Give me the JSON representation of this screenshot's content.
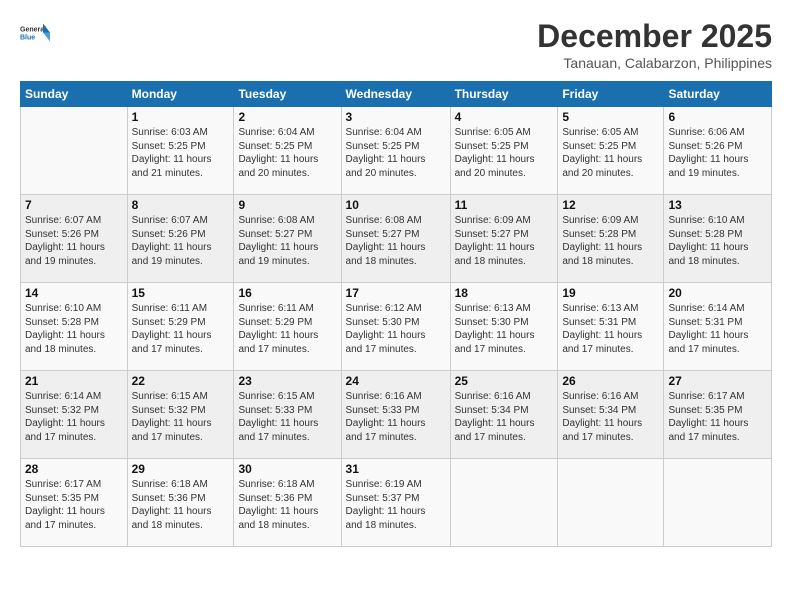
{
  "logo": {
    "line1": "General",
    "line2": "Blue"
  },
  "title": "December 2025",
  "subtitle": "Tanauan, Calabarzon, Philippines",
  "weekdays": [
    "Sunday",
    "Monday",
    "Tuesday",
    "Wednesday",
    "Thursday",
    "Friday",
    "Saturday"
  ],
  "weeks": [
    [
      {
        "day": "",
        "info": ""
      },
      {
        "day": "1",
        "info": "Sunrise: 6:03 AM\nSunset: 5:25 PM\nDaylight: 11 hours\nand 21 minutes."
      },
      {
        "day": "2",
        "info": "Sunrise: 6:04 AM\nSunset: 5:25 PM\nDaylight: 11 hours\nand 20 minutes."
      },
      {
        "day": "3",
        "info": "Sunrise: 6:04 AM\nSunset: 5:25 PM\nDaylight: 11 hours\nand 20 minutes."
      },
      {
        "day": "4",
        "info": "Sunrise: 6:05 AM\nSunset: 5:25 PM\nDaylight: 11 hours\nand 20 minutes."
      },
      {
        "day": "5",
        "info": "Sunrise: 6:05 AM\nSunset: 5:25 PM\nDaylight: 11 hours\nand 20 minutes."
      },
      {
        "day": "6",
        "info": "Sunrise: 6:06 AM\nSunset: 5:26 PM\nDaylight: 11 hours\nand 19 minutes."
      }
    ],
    [
      {
        "day": "7",
        "info": "Sunrise: 6:07 AM\nSunset: 5:26 PM\nDaylight: 11 hours\nand 19 minutes."
      },
      {
        "day": "8",
        "info": "Sunrise: 6:07 AM\nSunset: 5:26 PM\nDaylight: 11 hours\nand 19 minutes."
      },
      {
        "day": "9",
        "info": "Sunrise: 6:08 AM\nSunset: 5:27 PM\nDaylight: 11 hours\nand 19 minutes."
      },
      {
        "day": "10",
        "info": "Sunrise: 6:08 AM\nSunset: 5:27 PM\nDaylight: 11 hours\nand 18 minutes."
      },
      {
        "day": "11",
        "info": "Sunrise: 6:09 AM\nSunset: 5:27 PM\nDaylight: 11 hours\nand 18 minutes."
      },
      {
        "day": "12",
        "info": "Sunrise: 6:09 AM\nSunset: 5:28 PM\nDaylight: 11 hours\nand 18 minutes."
      },
      {
        "day": "13",
        "info": "Sunrise: 6:10 AM\nSunset: 5:28 PM\nDaylight: 11 hours\nand 18 minutes."
      }
    ],
    [
      {
        "day": "14",
        "info": "Sunrise: 6:10 AM\nSunset: 5:28 PM\nDaylight: 11 hours\nand 18 minutes."
      },
      {
        "day": "15",
        "info": "Sunrise: 6:11 AM\nSunset: 5:29 PM\nDaylight: 11 hours\nand 17 minutes."
      },
      {
        "day": "16",
        "info": "Sunrise: 6:11 AM\nSunset: 5:29 PM\nDaylight: 11 hours\nand 17 minutes."
      },
      {
        "day": "17",
        "info": "Sunrise: 6:12 AM\nSunset: 5:30 PM\nDaylight: 11 hours\nand 17 minutes."
      },
      {
        "day": "18",
        "info": "Sunrise: 6:13 AM\nSunset: 5:30 PM\nDaylight: 11 hours\nand 17 minutes."
      },
      {
        "day": "19",
        "info": "Sunrise: 6:13 AM\nSunset: 5:31 PM\nDaylight: 11 hours\nand 17 minutes."
      },
      {
        "day": "20",
        "info": "Sunrise: 6:14 AM\nSunset: 5:31 PM\nDaylight: 11 hours\nand 17 minutes."
      }
    ],
    [
      {
        "day": "21",
        "info": "Sunrise: 6:14 AM\nSunset: 5:32 PM\nDaylight: 11 hours\nand 17 minutes."
      },
      {
        "day": "22",
        "info": "Sunrise: 6:15 AM\nSunset: 5:32 PM\nDaylight: 11 hours\nand 17 minutes."
      },
      {
        "day": "23",
        "info": "Sunrise: 6:15 AM\nSunset: 5:33 PM\nDaylight: 11 hours\nand 17 minutes."
      },
      {
        "day": "24",
        "info": "Sunrise: 6:16 AM\nSunset: 5:33 PM\nDaylight: 11 hours\nand 17 minutes."
      },
      {
        "day": "25",
        "info": "Sunrise: 6:16 AM\nSunset: 5:34 PM\nDaylight: 11 hours\nand 17 minutes."
      },
      {
        "day": "26",
        "info": "Sunrise: 6:16 AM\nSunset: 5:34 PM\nDaylight: 11 hours\nand 17 minutes."
      },
      {
        "day": "27",
        "info": "Sunrise: 6:17 AM\nSunset: 5:35 PM\nDaylight: 11 hours\nand 17 minutes."
      }
    ],
    [
      {
        "day": "28",
        "info": "Sunrise: 6:17 AM\nSunset: 5:35 PM\nDaylight: 11 hours\nand 17 minutes."
      },
      {
        "day": "29",
        "info": "Sunrise: 6:18 AM\nSunset: 5:36 PM\nDaylight: 11 hours\nand 18 minutes."
      },
      {
        "day": "30",
        "info": "Sunrise: 6:18 AM\nSunset: 5:36 PM\nDaylight: 11 hours\nand 18 minutes."
      },
      {
        "day": "31",
        "info": "Sunrise: 6:19 AM\nSunset: 5:37 PM\nDaylight: 11 hours\nand 18 minutes."
      },
      {
        "day": "",
        "info": ""
      },
      {
        "day": "",
        "info": ""
      },
      {
        "day": "",
        "info": ""
      }
    ]
  ]
}
